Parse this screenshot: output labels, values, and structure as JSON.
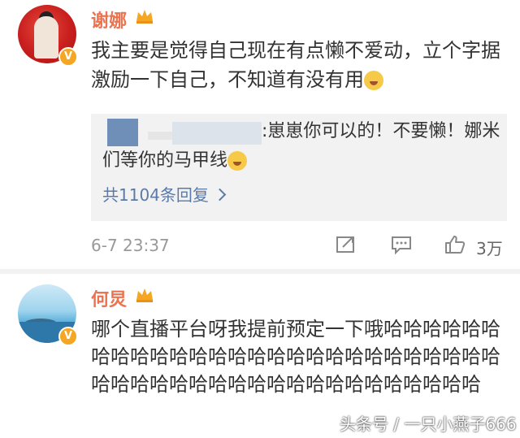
{
  "comments": [
    {
      "username": "谢娜",
      "text": "我主要是觉得自己现在有点懒不爱动，立个字据激励一下自己，不知道有没有用",
      "reply": {
        "text": ":崽崽你可以的！不要懒！娜米们等你的马甲线",
        "count_label": "共1104条回复"
      },
      "timestamp": "6-7 23:37",
      "likes": "3万"
    },
    {
      "username": "何炅",
      "text": "哪个直播平台呀我提前预定一下哦哈哈哈哈哈哈哈哈哈哈哈哈哈哈哈哈哈哈哈哈哈哈哈哈哈哈哈哈哈哈哈哈哈哈哈哈哈哈哈哈哈哈哈哈哈哈哈"
    }
  ],
  "watermark": "头条号 / 一只小燕子666",
  "colors": {
    "username": "#eb7350",
    "link": "#5b7aa8",
    "badge": "#f5a623"
  },
  "icons": [
    "share-icon",
    "comment-icon",
    "like-icon",
    "crown-icon",
    "verified-icon"
  ]
}
